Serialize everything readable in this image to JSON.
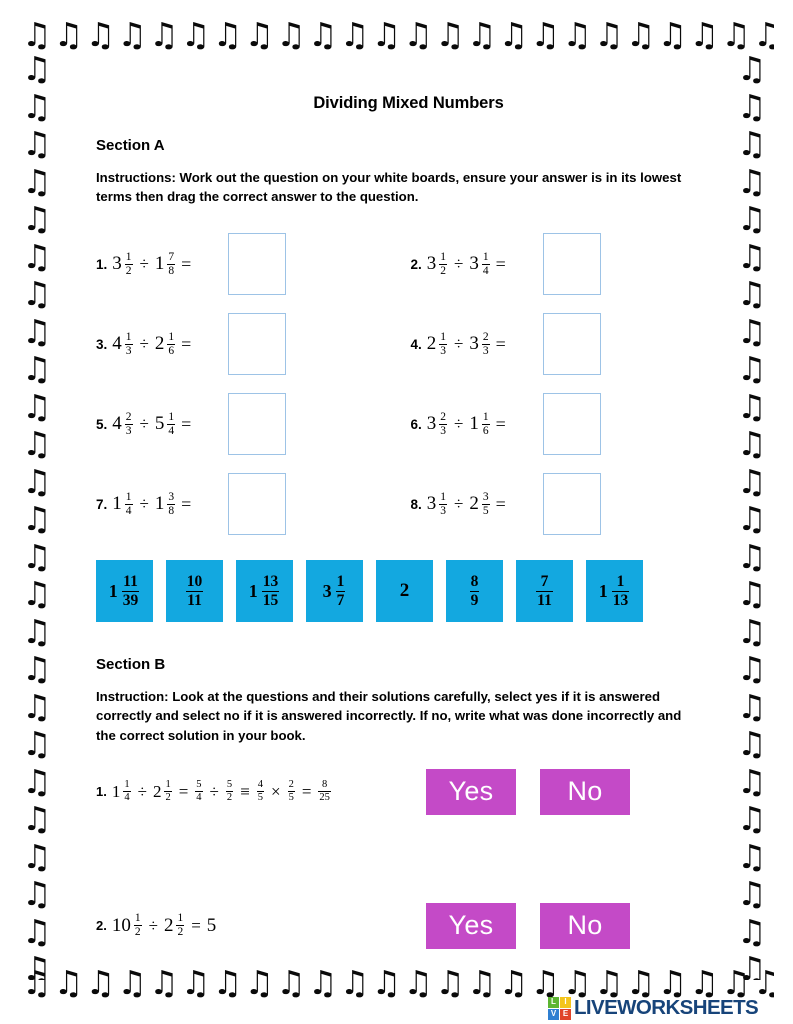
{
  "document": {
    "title": "Dividing Mixed Numbers",
    "border_glyph": "♫",
    "colors": {
      "tile_blue": "#13a8e0",
      "button_purple": "#c44ac7",
      "dropbox_border": "#9dc3e6",
      "logo_navy": "#17447a"
    }
  },
  "section_a": {
    "heading": "Section A",
    "instructions": "Instructions: Work out the question on your white boards, ensure your answer is in its lowest terms then drag the correct answer to the question.",
    "questions": [
      {
        "number": "1.",
        "a_whole": "3",
        "a_num": "1",
        "a_den": "2",
        "op": "÷",
        "b_whole": "1",
        "b_num": "7",
        "b_den": "8",
        "equals": "=",
        "answer": ""
      },
      {
        "number": "2.",
        "a_whole": "3",
        "a_num": "1",
        "a_den": "2",
        "op": "÷",
        "b_whole": "3",
        "b_num": "1",
        "b_den": "4",
        "equals": "=",
        "answer": ""
      },
      {
        "number": "3.",
        "a_whole": "4",
        "a_num": "1",
        "a_den": "3",
        "op": "÷",
        "b_whole": "2",
        "b_num": "1",
        "b_den": "6",
        "equals": "=",
        "answer": ""
      },
      {
        "number": "4.",
        "a_whole": "2",
        "a_num": "1",
        "a_den": "3",
        "op": "÷",
        "b_whole": "3",
        "b_num": "2",
        "b_den": "3",
        "equals": "=",
        "answer": ""
      },
      {
        "number": "5.",
        "a_whole": "4",
        "a_num": "2",
        "a_den": "3",
        "op": "÷",
        "b_whole": "5",
        "b_num": "1",
        "b_den": "4",
        "equals": "=",
        "answer": ""
      },
      {
        "number": "6.",
        "a_whole": "3",
        "a_num": "2",
        "a_den": "3",
        "op": "÷",
        "b_whole": "1",
        "b_num": "1",
        "b_den": "6",
        "equals": "=",
        "answer": ""
      },
      {
        "number": "7.",
        "a_whole": "1",
        "a_num": "1",
        "a_den": "4",
        "op": "÷",
        "b_whole": "1",
        "b_num": "3",
        "b_den": "8",
        "equals": "=",
        "answer": ""
      },
      {
        "number": "8.",
        "a_whole": "3",
        "a_num": "1",
        "a_den": "3",
        "op": "÷",
        "b_whole": "2",
        "b_num": "3",
        "b_den": "5",
        "equals": "=",
        "answer": ""
      }
    ],
    "answer_tiles": [
      {
        "whole": "1",
        "num": "11",
        "den": "39"
      },
      {
        "whole": "",
        "num": "10",
        "den": "11"
      },
      {
        "whole": "1",
        "num": "13",
        "den": "15"
      },
      {
        "whole": "3",
        "num": "1",
        "den": "7"
      },
      {
        "whole": "2",
        "num": "",
        "den": ""
      },
      {
        "whole": "",
        "num": "8",
        "den": "9"
      },
      {
        "whole": "",
        "num": "7",
        "den": "11"
      },
      {
        "whole": "1",
        "num": "1",
        "den": "13"
      }
    ]
  },
  "section_b": {
    "heading": "Section B",
    "instructions": "Instruction: Look at the questions and their solutions carefully, select yes if it is answered correctly and select no if it is answered incorrectly. If no, write what was done incorrectly and the correct solution in your book.",
    "questions": [
      {
        "number": "1.",
        "parts": [
          {
            "type": "mixed",
            "whole": "1",
            "num": "1",
            "den": "4"
          },
          {
            "type": "op",
            "symbol": "÷"
          },
          {
            "type": "mixed",
            "whole": "2",
            "num": "1",
            "den": "2"
          },
          {
            "type": "op",
            "symbol": "="
          },
          {
            "type": "frac",
            "num": "5",
            "den": "4"
          },
          {
            "type": "op",
            "symbol": "÷"
          },
          {
            "type": "frac",
            "num": "5",
            "den": "2"
          },
          {
            "type": "op",
            "symbol": "≡"
          },
          {
            "type": "frac",
            "num": "4",
            "den": "5"
          },
          {
            "type": "op",
            "symbol": "×"
          },
          {
            "type": "frac",
            "num": "2",
            "den": "5"
          },
          {
            "type": "op",
            "symbol": "="
          },
          {
            "type": "frac",
            "num": "8",
            "den": "25"
          }
        ],
        "yes_label": "Yes",
        "no_label": "No"
      },
      {
        "number": "2.",
        "parts": [
          {
            "type": "mixed",
            "whole": "10",
            "num": "1",
            "den": "2"
          },
          {
            "type": "op",
            "symbol": "÷"
          },
          {
            "type": "mixed",
            "whole": "2",
            "num": "1",
            "den": "2"
          },
          {
            "type": "op",
            "symbol": "="
          },
          {
            "type": "whole",
            "value": "5"
          }
        ],
        "yes_label": "Yes",
        "no_label": "No"
      }
    ]
  },
  "footer": {
    "badge_letters": [
      "L",
      "I",
      "V",
      "E"
    ],
    "wordmark": "LIVEWORKSHEETS"
  }
}
